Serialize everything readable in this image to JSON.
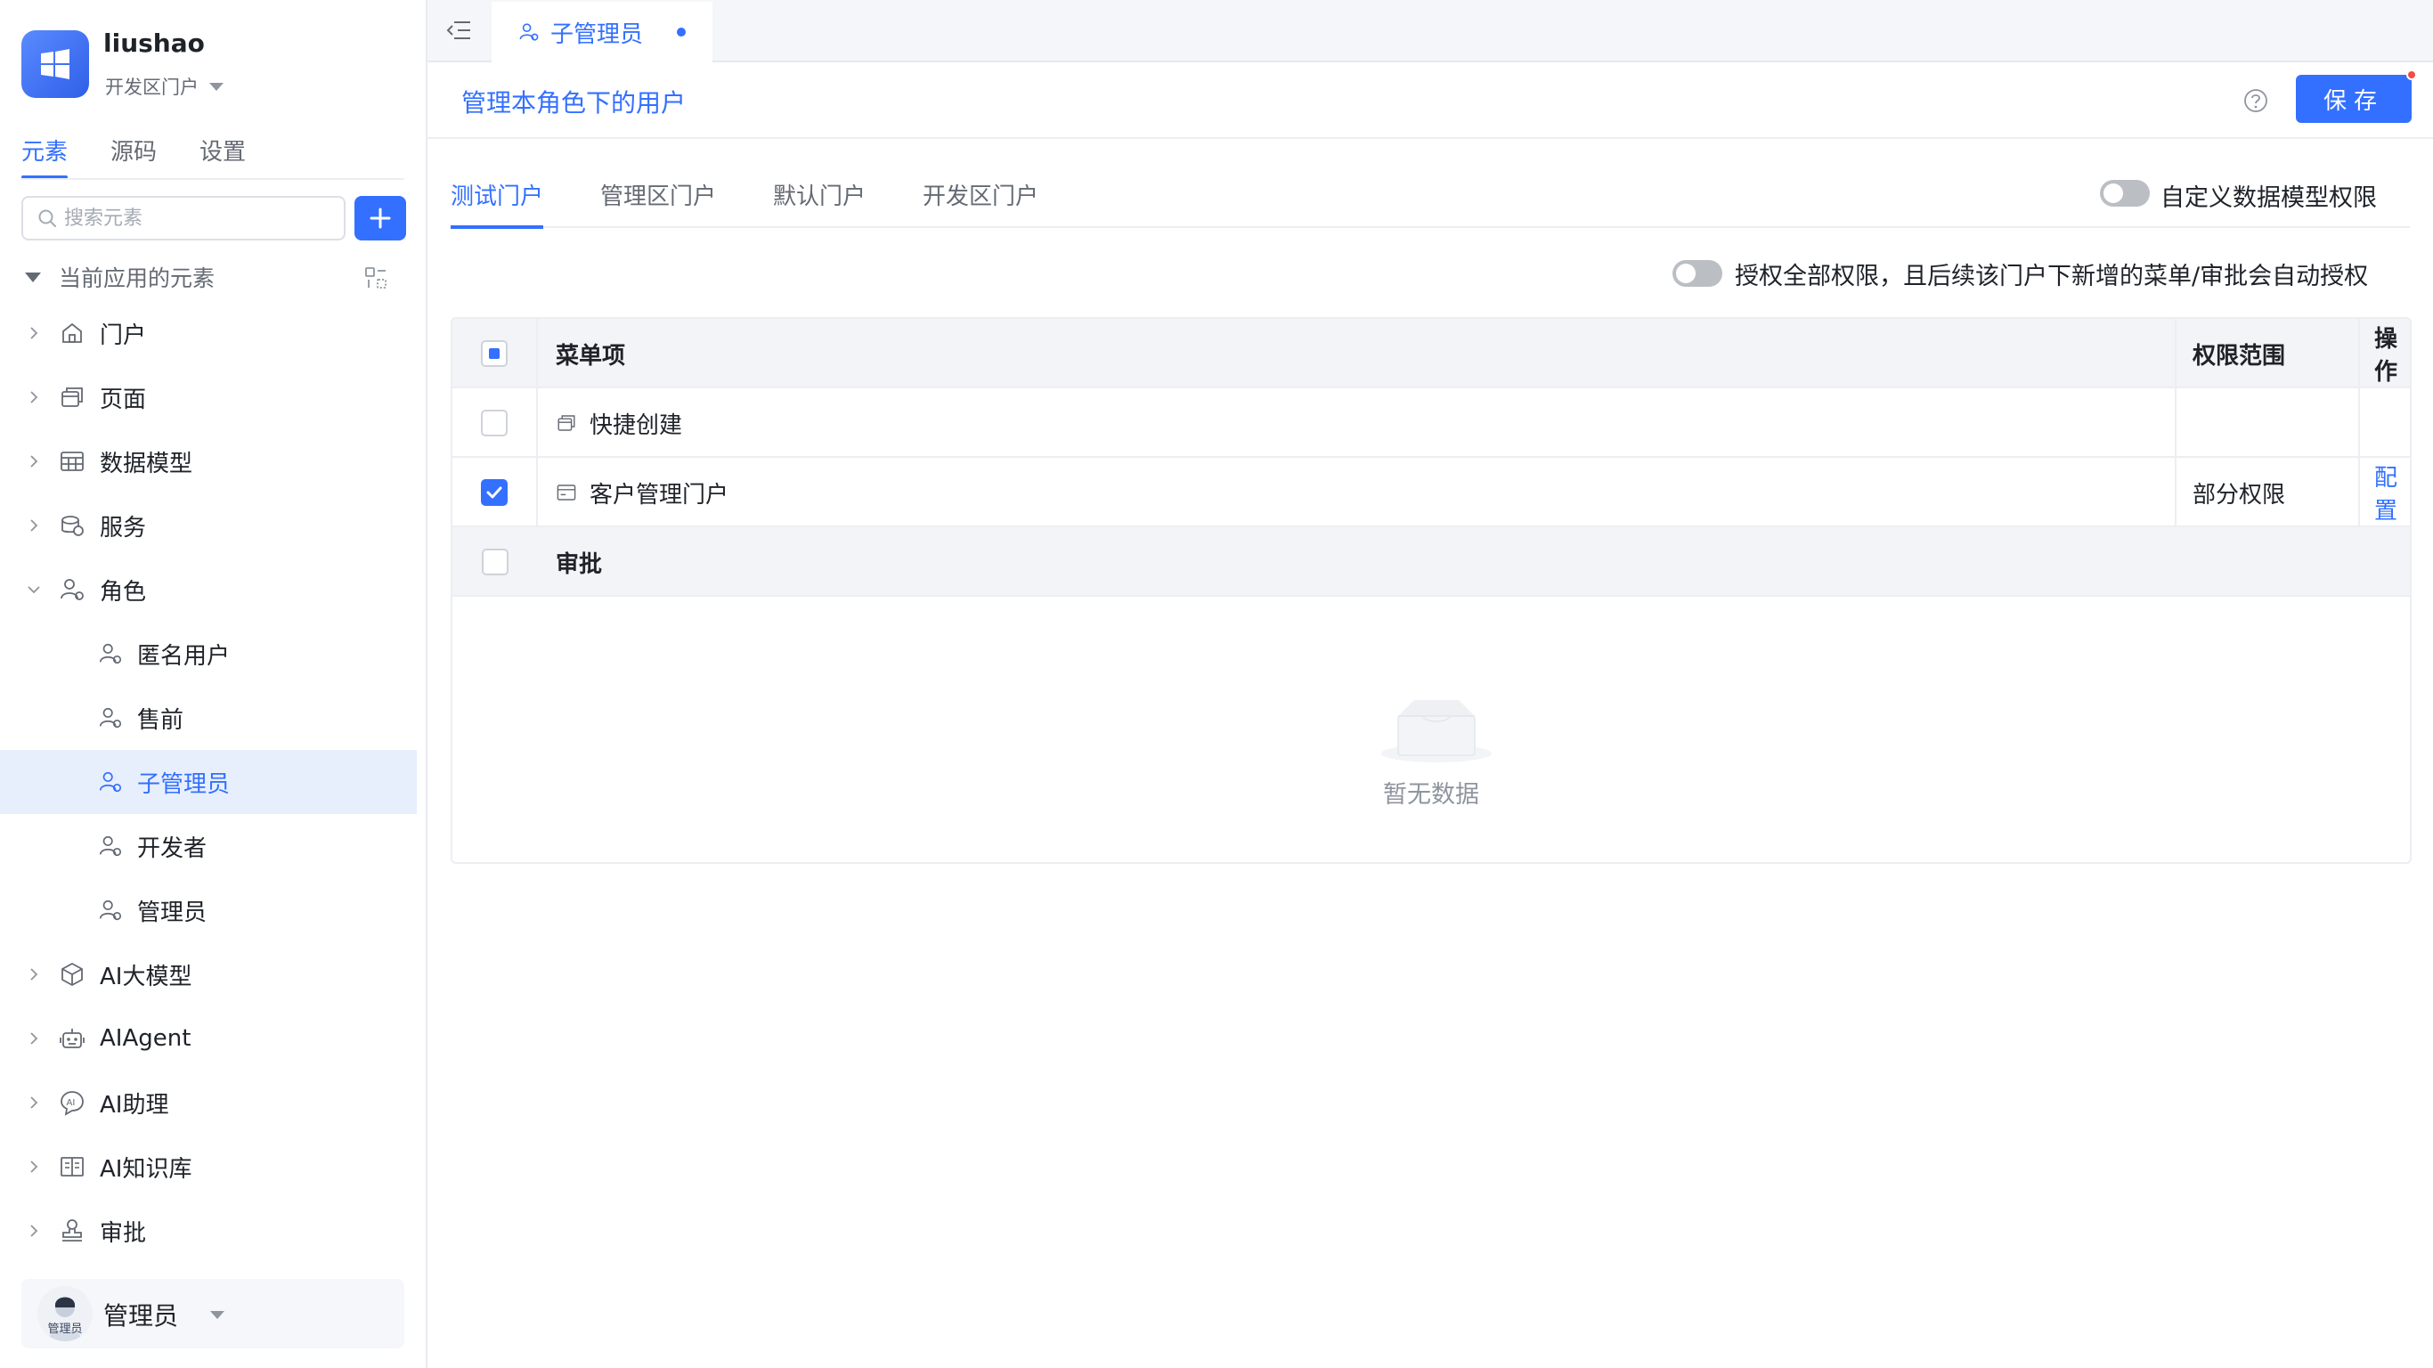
{
  "app": {
    "name": "liushao",
    "portal": "开发区门户"
  },
  "sidebar": {
    "tabs": [
      {
        "label": "元素",
        "active": true
      },
      {
        "label": "源码",
        "active": false
      },
      {
        "label": "设置",
        "active": false
      }
    ],
    "search": {
      "placeholder": "搜索元素",
      "value": ""
    },
    "tree_header": "当前应用的元素",
    "items": [
      {
        "label": "门户",
        "icon": "home-icon",
        "expanded": false
      },
      {
        "label": "页面",
        "icon": "page-icon",
        "expanded": false
      },
      {
        "label": "数据模型",
        "icon": "table-icon",
        "expanded": false
      },
      {
        "label": "服务",
        "icon": "service-icon",
        "expanded": false
      },
      {
        "label": "角色",
        "icon": "role-icon",
        "expanded": true
      },
      {
        "label": "匿名用户",
        "icon": "role-icon",
        "child": true
      },
      {
        "label": "售前",
        "icon": "role-icon",
        "child": true
      },
      {
        "label": "子管理员",
        "icon": "role-icon",
        "child": true,
        "selected": true
      },
      {
        "label": "开发者",
        "icon": "role-icon",
        "child": true
      },
      {
        "label": "管理员",
        "icon": "role-icon",
        "child": true
      },
      {
        "label": "AI大模型",
        "icon": "cube-icon",
        "expanded": false
      },
      {
        "label": "AIAgent",
        "icon": "robot-icon",
        "expanded": false
      },
      {
        "label": "AI助理",
        "icon": "ai-assistant-icon",
        "expanded": false
      },
      {
        "label": "AI知识库",
        "icon": "book-icon",
        "expanded": false
      },
      {
        "label": "审批",
        "icon": "stamp-icon",
        "expanded": false
      }
    ],
    "user": {
      "name": "管理员",
      "avatar_label": "管理员"
    }
  },
  "topbar": {
    "tab_label": "子管理员"
  },
  "subheader": {
    "title": "管理本角色下的用户",
    "save_label": "保存"
  },
  "portal_tabs": [
    {
      "label": "测试门户",
      "active": true
    },
    {
      "label": "管理区门户",
      "active": false
    },
    {
      "label": "默认门户",
      "active": false
    },
    {
      "label": "开发区门户",
      "active": false
    }
  ],
  "custom_model_switch": {
    "label": "自定义数据模型权限",
    "on": false
  },
  "grant_all_switch": {
    "label": "授权全部权限，且后续该门户下新增的菜单/审批会自动授权",
    "on": false
  },
  "table": {
    "columns": {
      "menu": "菜单项",
      "scope": "权限范围",
      "op": "操作"
    },
    "rows": [
      {
        "menu": "快捷创建",
        "icon": "page-icon",
        "checked": false,
        "scope": "",
        "op": ""
      },
      {
        "menu": "客户管理门户",
        "icon": "portal-icon",
        "checked": true,
        "scope": "部分权限",
        "op": "配置"
      }
    ],
    "group_label": "审批",
    "empty_text": "暂无数据"
  },
  "colors": {
    "accent": "#3370ff",
    "selected_bg": "#e8effc",
    "badge_red": "#f54a45"
  }
}
